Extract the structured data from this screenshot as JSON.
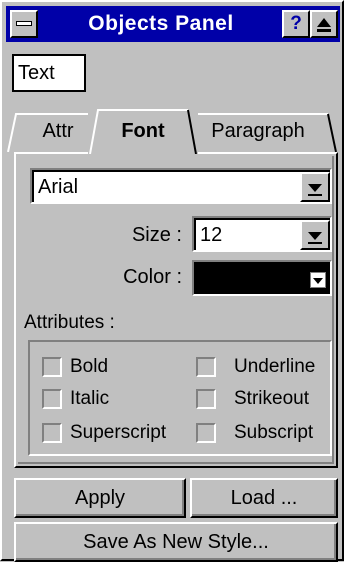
{
  "window": {
    "title": "Objects Panel",
    "help_label": "?",
    "system_menu_icon": "dash-icon",
    "rollup_icon": "rollup-triangle-icon"
  },
  "object_type": "Text",
  "tabs": [
    {
      "label": "Attr",
      "active": false
    },
    {
      "label": "Font",
      "active": true
    },
    {
      "label": "Paragraph",
      "active": false
    }
  ],
  "font": {
    "family": "Arial",
    "size_label": "Size :",
    "size_value": "12",
    "color_label": "Color :",
    "color_value": "#000000"
  },
  "attributes": {
    "heading": "Attributes :",
    "options": [
      {
        "label": "Bold",
        "checked": false
      },
      {
        "label": "Underline",
        "checked": false
      },
      {
        "label": "Italic",
        "checked": false
      },
      {
        "label": "Strikeout",
        "checked": false
      },
      {
        "label": "Superscript",
        "checked": false
      },
      {
        "label": "Subscript",
        "checked": false
      }
    ]
  },
  "buttons": {
    "apply": "Apply",
    "load": "Load ...",
    "save_as_new_style": "Save As New Style..."
  },
  "colors": {
    "titlebar": "#0000a8",
    "face": "#c0c0c0"
  }
}
